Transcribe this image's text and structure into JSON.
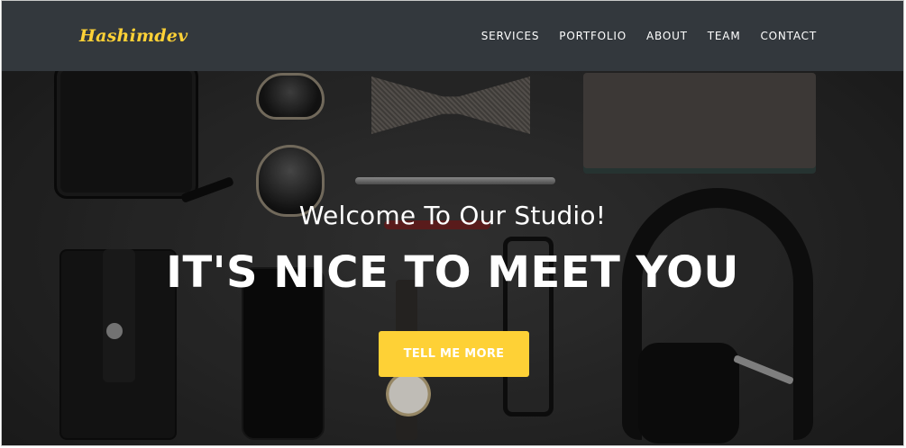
{
  "brand": {
    "name": "Hashimdev",
    "color": "#fed136"
  },
  "nav": {
    "items": [
      {
        "label": "SERVICES"
      },
      {
        "label": "PORTFOLIO"
      },
      {
        "label": "ABOUT"
      },
      {
        "label": "TEAM"
      },
      {
        "label": "CONTACT"
      }
    ],
    "background": "#33383d"
  },
  "hero": {
    "subheading": "Welcome To Our Studio!",
    "heading": "IT'S NICE TO MEET YOU",
    "cta_label": "TELL ME MORE",
    "accent": "#fed136",
    "background_description": "flat-lay-accessories-photo"
  }
}
